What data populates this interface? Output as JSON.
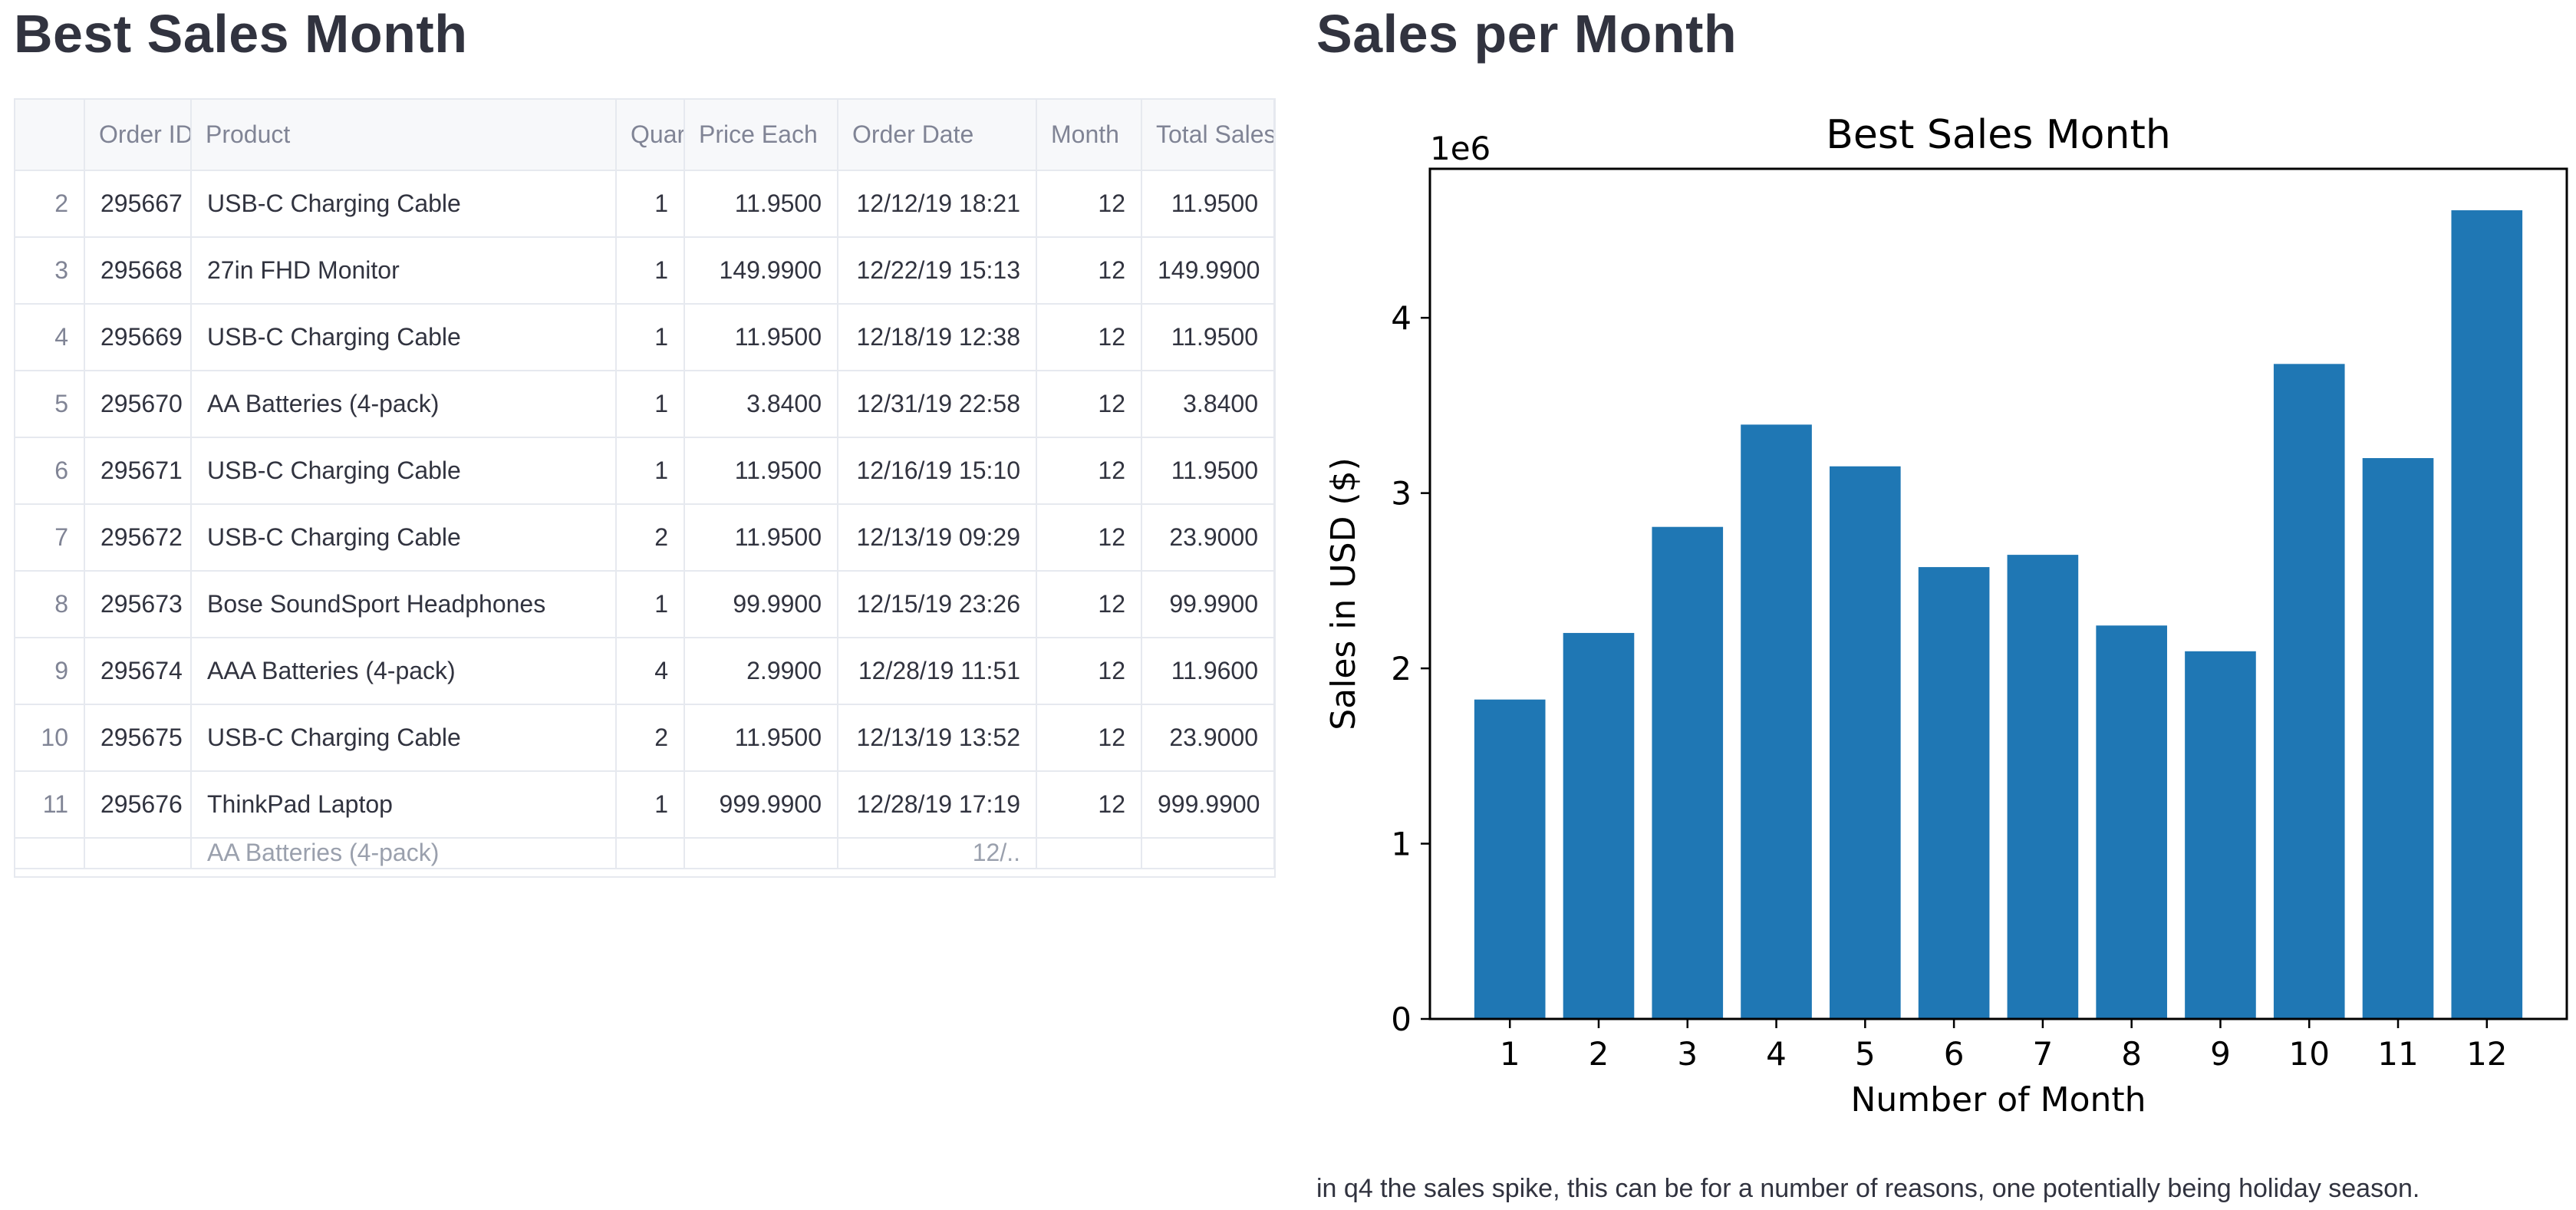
{
  "left": {
    "title": "Best Sales Month",
    "table": {
      "columns": [
        "",
        "Order ID",
        "Product",
        "Quar",
        "Price Each",
        "Order Date",
        "Month",
        "Total Sales"
      ],
      "rows": [
        [
          "2",
          "295667",
          "USB-C Charging Cable",
          "1",
          "11.9500",
          "12/12/19 18:21",
          "12",
          "11.9500"
        ],
        [
          "3",
          "295668",
          "27in FHD Monitor",
          "1",
          "149.9900",
          "12/22/19 15:13",
          "12",
          "149.9900"
        ],
        [
          "4",
          "295669",
          "USB-C Charging Cable",
          "1",
          "11.9500",
          "12/18/19 12:38",
          "12",
          "11.9500"
        ],
        [
          "5",
          "295670",
          "AA Batteries (4-pack)",
          "1",
          "3.8400",
          "12/31/19 22:58",
          "12",
          "3.8400"
        ],
        [
          "6",
          "295671",
          "USB-C Charging Cable",
          "1",
          "11.9500",
          "12/16/19 15:10",
          "12",
          "11.9500"
        ],
        [
          "7",
          "295672",
          "USB-C Charging Cable",
          "2",
          "11.9500",
          "12/13/19 09:29",
          "12",
          "23.9000"
        ],
        [
          "8",
          "295673",
          "Bose SoundSport Headphones",
          "1",
          "99.9900",
          "12/15/19 23:26",
          "12",
          "99.9900"
        ],
        [
          "9",
          "295674",
          "AAA Batteries (4-pack)",
          "4",
          "2.9900",
          "12/28/19 11:51",
          "12",
          "11.9600"
        ],
        [
          "10",
          "295675",
          "USB-C Charging Cable",
          "2",
          "11.9500",
          "12/13/19 13:52",
          "12",
          "23.9000"
        ],
        [
          "11",
          "295676",
          "ThinkPad Laptop",
          "1",
          "999.9900",
          "12/28/19 17:19",
          "12",
          "999.9900"
        ]
      ],
      "partial_row": [
        "",
        "",
        "AA Batteries (4-pack)",
        "",
        "",
        "12/..",
        "",
        ""
      ]
    }
  },
  "right": {
    "title": "Sales per Month",
    "caption": "in q4 the sales spike, this can be for a number of reasons, one potentially being holiday season."
  },
  "chart_data": {
    "type": "bar",
    "title": "Best Sales Month",
    "xlabel": "Number of Month",
    "ylabel": "Sales in USD ($)",
    "y_scale_label": "1e6",
    "categories": [
      "1",
      "2",
      "3",
      "4",
      "5",
      "6",
      "7",
      "8",
      "9",
      "10",
      "11",
      "12"
    ],
    "values": [
      1822257,
      2202022,
      2807100,
      3390670,
      3152607,
      2577802,
      2647776,
      2244468,
      2097560,
      3736727,
      3199603,
      4613443
    ],
    "ylim": [
      0,
      4850000
    ],
    "yticks": [
      0,
      1,
      2,
      3,
      4
    ],
    "bar_color": "#1f77b4",
    "grid": false,
    "legend": "none"
  }
}
